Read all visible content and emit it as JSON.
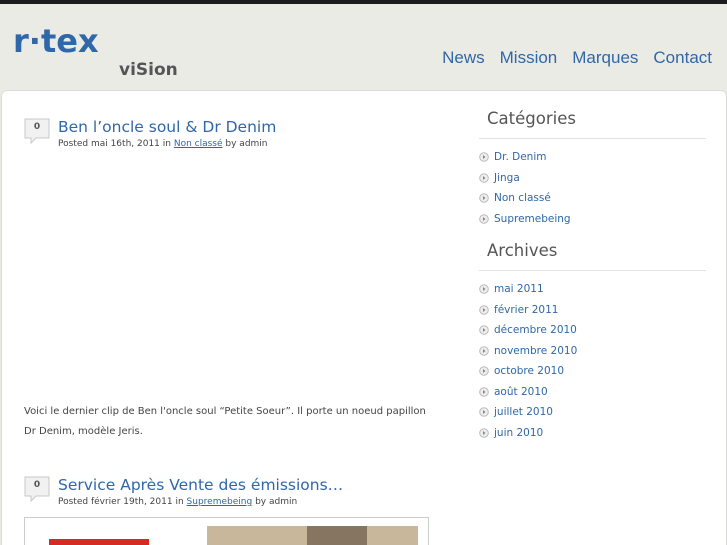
{
  "header": {
    "logo": {
      "brand_main": "r·tex",
      "brand_sub": "viSion"
    },
    "nav": [
      "News",
      "Mission",
      "Marques",
      "Contact"
    ]
  },
  "posts": [
    {
      "comments": "0",
      "title": "Ben l’oncle soul & Dr Denim",
      "meta": {
        "posted": "Posted mai 16th, 2011 in",
        "category": "Non classé",
        "by": "by admin"
      },
      "text": "Voici le dernier clip de Ben l'oncle soul “Petite Soeur”. Il porte un noeud papillon Dr Denim, modèle Jeris."
    },
    {
      "comments": "0",
      "title": "Service Après Vente des émissions…",
      "meta": {
        "posted": "Posted février 19th, 2011 in",
        "category": "Supremebeing",
        "by": "by admin"
      }
    }
  ],
  "sidebar": {
    "categories": {
      "heading": "Catégories",
      "items": [
        "Dr. Denim",
        "Jinga",
        "Non classé",
        "Supremebeing"
      ]
    },
    "archives": {
      "heading": "Archives",
      "items": [
        "mai 2011",
        "février 2011",
        "décembre 2010",
        "novembre 2010",
        "octobre 2010",
        "août 2010",
        "juillet 2010",
        "juin 2010"
      ]
    }
  },
  "colors": {
    "link": "#2f67a8",
    "background": "#ebebe6",
    "logo_blue": "#2f67a8",
    "logo_sub": "#555555"
  }
}
